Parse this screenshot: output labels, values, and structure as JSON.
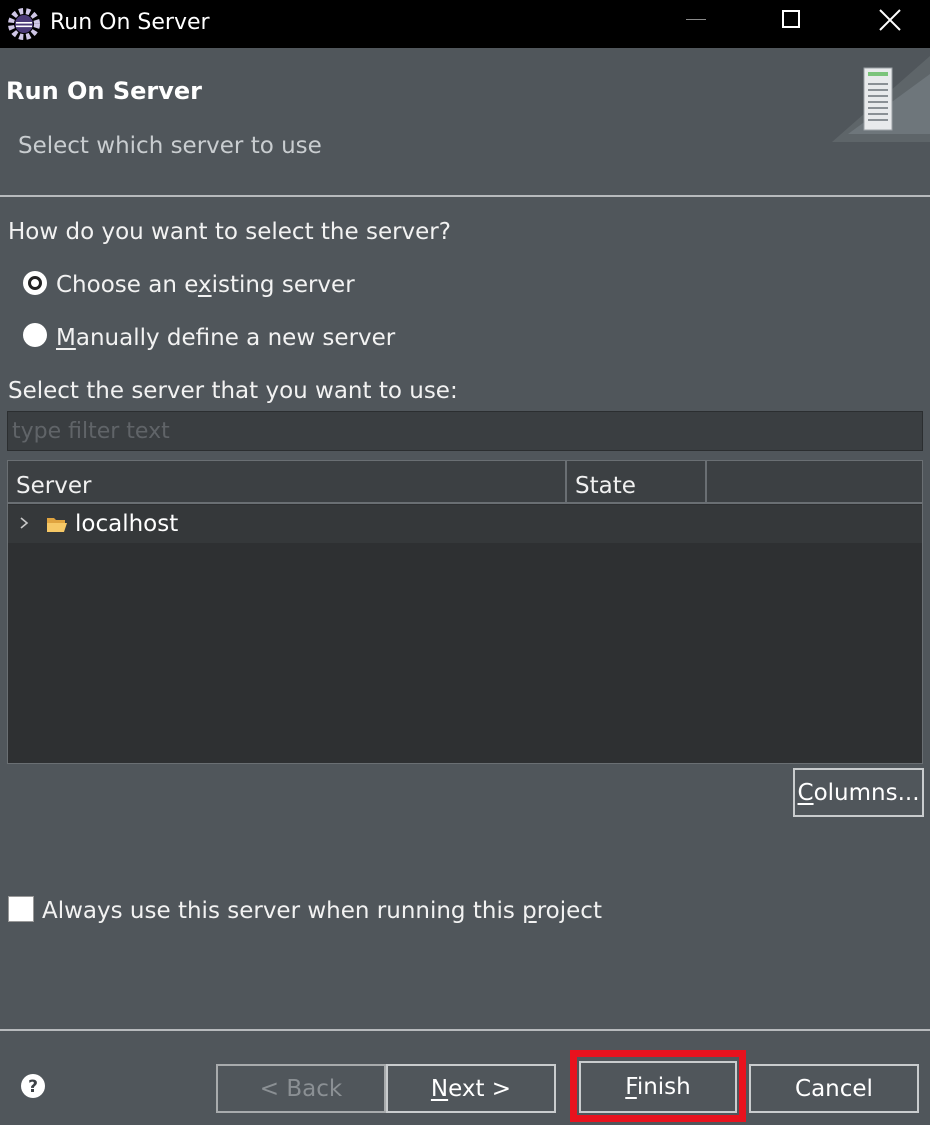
{
  "window": {
    "title": "Run On Server"
  },
  "banner": {
    "title": "Run On Server",
    "subtitle": "Select which server to use"
  },
  "form": {
    "question": "How do you want to select the server?",
    "radio_existing": {
      "pre": "Choose an e",
      "u": "x",
      "post": "isting server",
      "selected": true
    },
    "radio_manual": {
      "pre": "",
      "u": "M",
      "post": "anually define a new server",
      "selected": false
    },
    "select_prompt": "Select the server that you want to use:",
    "filter_placeholder": "type filter text"
  },
  "table": {
    "columns": [
      "Server",
      "State",
      ""
    ],
    "rows": [
      {
        "label": "localhost",
        "state": ""
      }
    ]
  },
  "columns_button": {
    "u": "C",
    "post": "olumns..."
  },
  "always_use": {
    "pre": "Always use this server when running this ",
    "u": "p",
    "post": "roject",
    "checked": false
  },
  "buttons": {
    "back": {
      "label": "< Back",
      "enabled": false
    },
    "next": {
      "u": "N",
      "post": "ext >"
    },
    "finish": {
      "u": "F",
      "post": "inish"
    },
    "cancel": {
      "label": "Cancel"
    }
  },
  "colors": {
    "background": "#50565b",
    "titlebar": "#000000",
    "highlight": "#e8121e",
    "table_bg": "#2e3032"
  },
  "icons": {
    "app": "eclipse-icon",
    "banner": "server-icon",
    "tree": "folder-icon",
    "help": "help-icon"
  }
}
